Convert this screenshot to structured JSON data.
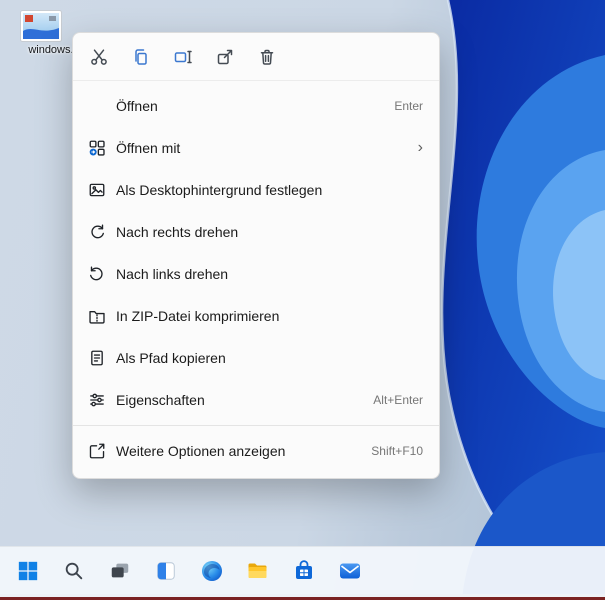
{
  "desktop": {
    "icon_label": "windows...",
    "wallpaper_colors": {
      "light": "#ced9e6",
      "navy": "#0a2aa2",
      "blue": "#1552cc",
      "bright": "#2e7bde",
      "highlight": "#5aa3f0"
    }
  },
  "context_menu": {
    "toolbar_icons": [
      {
        "name": "cut"
      },
      {
        "name": "copy"
      },
      {
        "name": "rename"
      },
      {
        "name": "share"
      },
      {
        "name": "delete"
      }
    ],
    "items": [
      {
        "label": "Öffnen",
        "shortcut": "Enter",
        "icon": ""
      },
      {
        "label": "Öffnen mit",
        "shortcut": "",
        "icon": "open-with",
        "submenu": true
      },
      {
        "label": "Als Desktophintergrund festlegen",
        "shortcut": "",
        "icon": "set-wallpaper"
      },
      {
        "label": "Nach rechts drehen",
        "shortcut": "",
        "icon": "rotate-right"
      },
      {
        "label": "Nach links drehen",
        "shortcut": "",
        "icon": "rotate-left"
      },
      {
        "label": "In ZIP-Datei komprimieren",
        "shortcut": "",
        "icon": "zip-compress"
      },
      {
        "label": "Als Pfad kopieren",
        "shortcut": "",
        "icon": "copy-path"
      },
      {
        "label": "Eigenschaften",
        "shortcut": "Alt+Enter",
        "icon": "properties"
      },
      {
        "label": "Weitere Optionen anzeigen",
        "shortcut": "Shift+F10",
        "icon": "more-options"
      }
    ]
  },
  "taskbar": {
    "icons": [
      "start",
      "search",
      "task-view",
      "widgets",
      "edge",
      "file-explorer",
      "store",
      "mail"
    ]
  }
}
